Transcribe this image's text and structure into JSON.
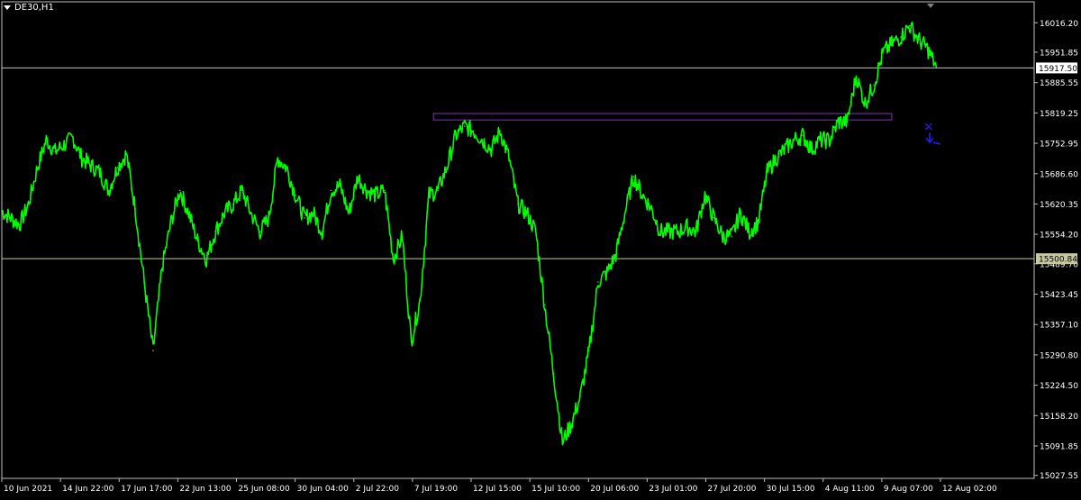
{
  "title": "DE30,H1",
  "colors": {
    "background": "#000000",
    "candle": "#00ff00",
    "axis": "#c0c0c0",
    "text": "#ffffff",
    "hline": "#c8c8a0",
    "rect": "#8a30c0",
    "arrow": "#2020ff"
  },
  "chart_data": {
    "type": "line",
    "title": "DE30,H1",
    "y_ticks": [
      "16016.20",
      "15951.85",
      "15885.55",
      "15819.25",
      "15752.95",
      "15686.60",
      "15620.35",
      "15554.20",
      "15489.70",
      "15423.45",
      "15357.10",
      "15290.80",
      "15224.50",
      "15158.20",
      "15091.85",
      "15027.55"
    ],
    "x_ticks": [
      "10 Jun 2021",
      "14 Jun 22:00",
      "17 Jun 17:00",
      "22 Jun 13:00",
      "25 Jun 08:00",
      "30 Jun 04:00",
      "2 Jul 22:00",
      "7 Jul 19:00",
      "12 Jul 15:00",
      "15 Jul 10:00",
      "20 Jul 06:00",
      "23 Jul 01:00",
      "27 Jul 20:00",
      "30 Jul 15:00",
      "4 Aug 11:00",
      "9 Aug 07:00",
      "12 Aug 02:00"
    ],
    "price_labels": [
      {
        "value": 15917.5,
        "text": "15917.50"
      },
      {
        "value": 15500.84,
        "text": "15500.84"
      }
    ],
    "zone": {
      "x_start": 48.5,
      "x_end": 100.0,
      "y_low": 15804,
      "y_high": 15818
    },
    "ylim": [
      15021,
      16062
    ],
    "xlim": [
      0,
      116
    ],
    "x": [
      0,
      1,
      2,
      3,
      4,
      5,
      6,
      7,
      8,
      9,
      10,
      11,
      12,
      13,
      14,
      15,
      16,
      17,
      18,
      19,
      20,
      21,
      22,
      23,
      24,
      25,
      26,
      27,
      28,
      29,
      30,
      31,
      32,
      33,
      34,
      35,
      36,
      37,
      38,
      39,
      40,
      41,
      42,
      43,
      44,
      45,
      46,
      47,
      48,
      49,
      50,
      51,
      52,
      53,
      54,
      55,
      56,
      57,
      58,
      59,
      60,
      61,
      62,
      63,
      64,
      65,
      66,
      67,
      68,
      69,
      70,
      71,
      72,
      73,
      74,
      75,
      76,
      77,
      78,
      79,
      80,
      81,
      82,
      83,
      84,
      85,
      86,
      87,
      88,
      89,
      90,
      91,
      92,
      93,
      94,
      95,
      96,
      97,
      98,
      99,
      100,
      101,
      102,
      103,
      104,
      105
    ],
    "values": [
      15605,
      15590,
      15575,
      15620,
      15700,
      15760,
      15735,
      15750,
      15765,
      15720,
      15705,
      15690,
      15650,
      15700,
      15730,
      15610,
      15450,
      15300,
      15480,
      15580,
      15650,
      15600,
      15540,
      15500,
      15560,
      15600,
      15620,
      15650,
      15600,
      15560,
      15590,
      15720,
      15700,
      15640,
      15590,
      15600,
      15560,
      15650,
      15660,
      15600,
      15680,
      15650,
      15640,
      15650,
      15500,
      15550,
      15320,
      15410,
      15640,
      15650,
      15700,
      15770,
      15790,
      15780,
      15760,
      15740,
      15780,
      15720,
      15620,
      15600,
      15560,
      15400,
      15250,
      15100,
      15140,
      15200,
      15300,
      15450,
      15470,
      15510,
      15600,
      15680,
      15640,
      15610,
      15560,
      15560,
      15560,
      15570,
      15560,
      15640,
      15590,
      15550,
      15550,
      15600,
      15560,
      15580,
      15690,
      15720,
      15740,
      15760,
      15770,
      15740,
      15760,
      15760,
      15800,
      15800,
      15900,
      15840,
      15880,
      15950,
      15970,
      15985,
      16010,
      15980,
      15960,
      15920
    ]
  }
}
